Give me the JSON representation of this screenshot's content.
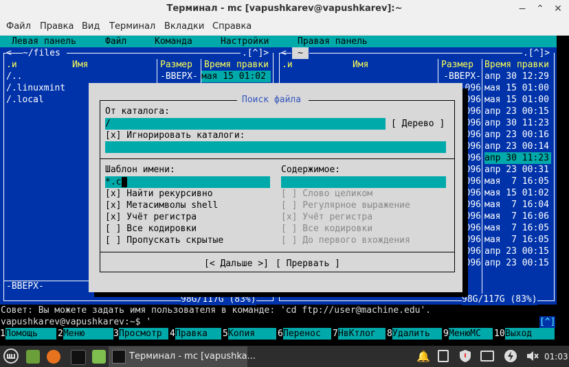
{
  "window": {
    "title": "Терминал - mc [vapushkarev@vapushkarev]:~"
  },
  "menu": [
    "Файл",
    "Правка",
    "Вид",
    "Терминал",
    "Вкладки",
    "Справка"
  ],
  "mc_menu": [
    "Левая панель",
    "Файл",
    "Команда",
    "Настройки",
    "Правая панель"
  ],
  "left_panel": {
    "path": "~/files",
    "corner": ".[^]>",
    "col_sort": ".и",
    "col_name": "Имя",
    "col_size": "Размер",
    "col_time": "Время правки",
    "rows": [
      {
        "name": "/..",
        "size": "-ВВЕРХ-",
        "time": "мая 15 01:02"
      },
      {
        "name": "/.linuxmint",
        "size": "",
        "time": ""
      },
      {
        "name": "/.local",
        "size": "",
        "time": ""
      }
    ],
    "status": "-ВВЕРХ-",
    "disk": "98G/117G (83%)"
  },
  "right_panel": {
    "path": "~",
    "corner": ".[^]>",
    "col_sort": ".и",
    "col_name": "Имя",
    "col_size": "Размер",
    "col_time": "Время правки",
    "rows": [
      {
        "size": "-ВВЕРХ-",
        "time": "апр 30 12:29"
      },
      {
        "size": "096",
        "time": "мая 15 01:00"
      },
      {
        "size": "096",
        "time": "мая 15 01:00"
      },
      {
        "size": "096",
        "time": "апр 23 00:15"
      },
      {
        "size": "096",
        "time": "апр 30 11:23"
      },
      {
        "size": "096",
        "time": "апр 23 00:16"
      },
      {
        "size": "096",
        "time": "апр 23 00:14"
      },
      {
        "size": "096",
        "time": "апр 30 11:23"
      },
      {
        "size": "096",
        "time": "апр 23 00:31"
      },
      {
        "size": "096",
        "time": "мая  7 16:05"
      },
      {
        "size": "096",
        "time": "мая 15 01:02"
      },
      {
        "size": "096",
        "time": "мая  7 16:04"
      },
      {
        "size": "096",
        "time": "мая  7 16:06"
      },
      {
        "size": "096",
        "time": "мая  7 16:05"
      },
      {
        "size": "096",
        "time": "мая  7 16:05"
      },
      {
        "size": "096",
        "time": "апр 23 00:15"
      },
      {
        "size": "096",
        "time": "апр 23 00:15"
      }
    ],
    "disk": "98G/117G (83%)"
  },
  "dialog": {
    "title": "Поиск файла",
    "from_dir_label": "От каталога:",
    "from_dir_value": "/",
    "tree_button": "[ Дерево ]",
    "ignore_dirs": "[x] Игнорировать каталоги:",
    "name_pattern_label": "Шаблон имени:",
    "name_pattern_value": "*.c",
    "content_label": "Содержимое:",
    "left_options": [
      "[x] Найти рекурсивно",
      "[x] Метасимволы shell",
      "[x] Учёт регистра",
      "[ ] Все кодировки",
      "[ ] Пропускать скрытые"
    ],
    "right_options": [
      "[ ] Слово целиком",
      "[ ] Регулярное выражение",
      "[x] Учёт регистра",
      "[ ] Все кодировки",
      "[ ] До первого вхождения"
    ],
    "next_button": "[< Дальше >]",
    "cancel_button": "[ Прервать ]"
  },
  "hint": "Совет: Вы можете задать имя пользователя в команде: 'cd ftp://user@machine.edu'.",
  "prompt": "vapushkarev@vapushkarev:~$ '",
  "prompt_corner": "[^]",
  "fkeys": [
    {
      "n": "1",
      "label": "Помощь"
    },
    {
      "n": "2",
      "label": "Меню"
    },
    {
      "n": "3",
      "label": "Просмотр"
    },
    {
      "n": "4",
      "label": "Правка"
    },
    {
      "n": "5",
      "label": "Копия"
    },
    {
      "n": "6",
      "label": "Перенос"
    },
    {
      "n": "7",
      "label": "НвКтлог"
    },
    {
      "n": "8",
      "label": "Удалить"
    },
    {
      "n": "9",
      "label": "МенюMC"
    },
    {
      "n": "10",
      "label": "Выход"
    }
  ],
  "taskbar": {
    "task_title": "Терминал - mc [vapushka...",
    "clock": "01:03"
  }
}
